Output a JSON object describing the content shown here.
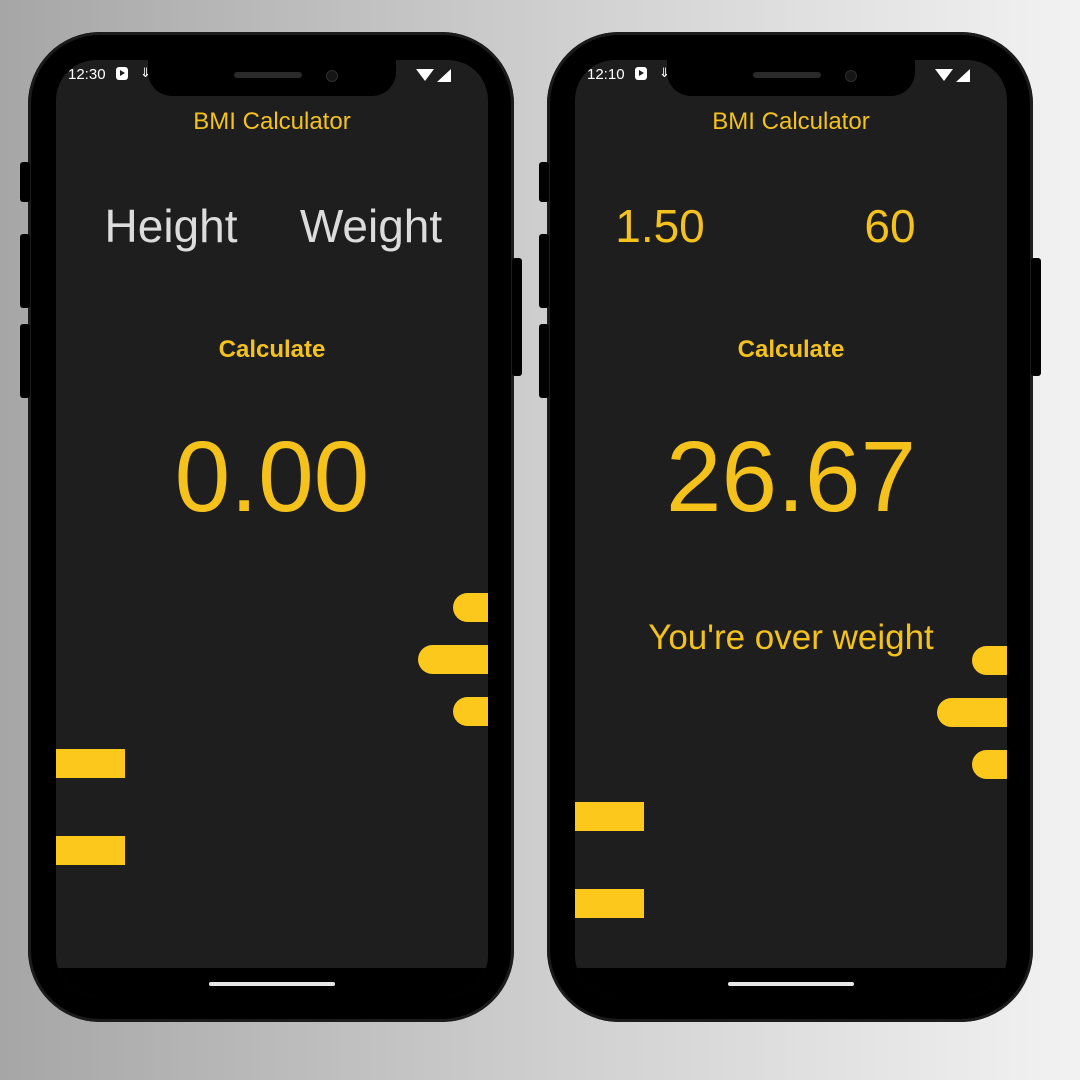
{
  "colors": {
    "accent": "#f4c21b",
    "screen_bg": "#1e1e1e",
    "page_bg": "#bdbdbd"
  },
  "screen_left": {
    "status": {
      "time": "12:30",
      "icons": [
        "play-shield-icon",
        "download-icon",
        "wifi-icon",
        "signal-icon"
      ]
    },
    "app_title": "BMI Calculator",
    "height_placeholder": "Height",
    "weight_placeholder": "Weight",
    "calculate_label": "Calculate",
    "result_value": "0.00"
  },
  "screen_right": {
    "status": {
      "time": "12:10",
      "icons": [
        "play-shield-icon",
        "download-icon",
        "wifi-icon",
        "signal-icon"
      ]
    },
    "app_title": "BMI Calculator",
    "height_value": "1.50",
    "weight_value": "60",
    "calculate_label": "Calculate",
    "result_value": "26.67",
    "result_message": "You're over weight"
  }
}
